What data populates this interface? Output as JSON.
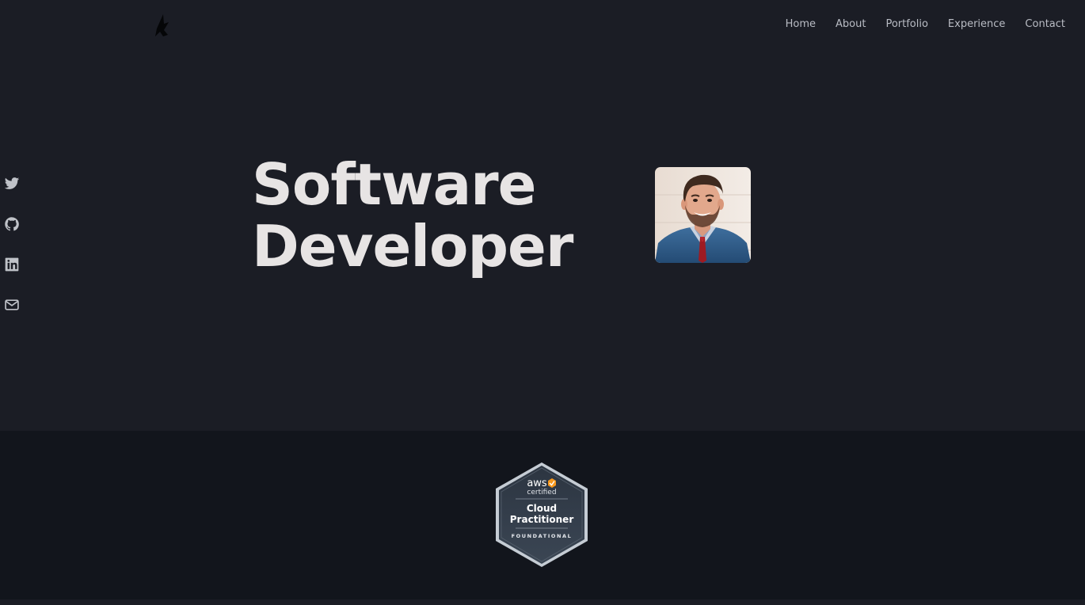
{
  "nav": {
    "items": [
      {
        "label": "Home"
      },
      {
        "label": "About"
      },
      {
        "label": "Portfolio"
      },
      {
        "label": "Experience"
      },
      {
        "label": "Contact"
      }
    ]
  },
  "social": [
    "twitter-icon",
    "github-icon",
    "linkedin-icon",
    "mail-icon"
  ],
  "hero": {
    "title_line1": "Software",
    "title_line2": "Developer"
  },
  "badge": {
    "brand": "aws",
    "certified": "certified",
    "line1": "Cloud",
    "line2": "Practitioner",
    "level": "FOUNDATIONAL"
  },
  "colors": {
    "background": "#1b1d25",
    "band": "#12151c",
    "heading": "#e7e4e4",
    "nav_text": "#b9bcc4",
    "aws_accent": "#f7981d"
  }
}
